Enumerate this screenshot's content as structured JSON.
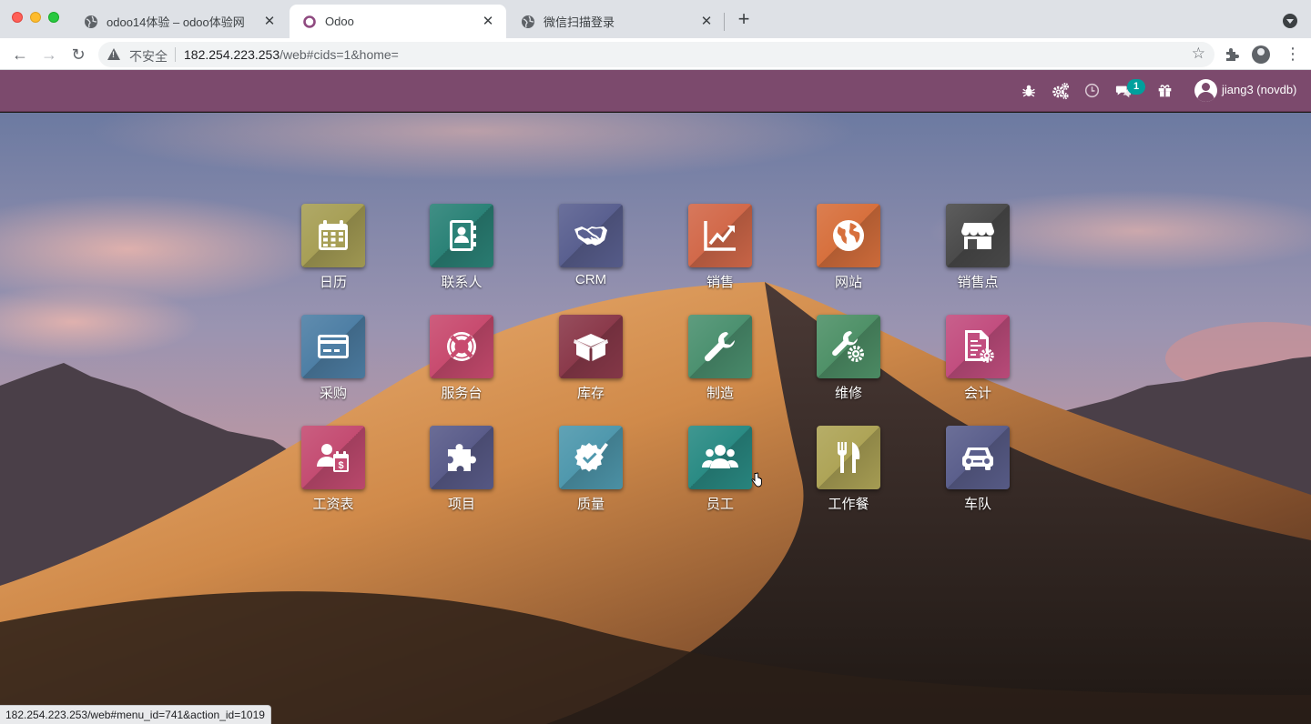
{
  "browser": {
    "tabs": [
      {
        "title": "odoo14体验 – odoo体验网",
        "favicon": "globe-icon",
        "active": false
      },
      {
        "title": "Odoo",
        "favicon": "odoo-icon",
        "active": true
      },
      {
        "title": "微信扫描登录",
        "favicon": "globe-icon",
        "active": false
      }
    ],
    "new_tab": "+",
    "security_label": "不安全",
    "url_host": "182.254.223.253",
    "url_path": "/web#cids=1&home=",
    "status_url": "182.254.223.253/web#menu_id=741&action_id=1019"
  },
  "navbar": {
    "icons": [
      "bug-icon",
      "gears-icon",
      "clock-icon",
      "chat-icon",
      "gift-icon"
    ],
    "message_badge": "1",
    "user": "jiang3 (novdb)"
  },
  "apps": [
    {
      "label": "日历",
      "icon": "calendar-icon",
      "color": "#a79f56"
    },
    {
      "label": "联系人",
      "icon": "contacts-icon",
      "color": "#2b8277"
    },
    {
      "label": "CRM",
      "icon": "handshake-icon",
      "color": "#5a6090"
    },
    {
      "label": "销售",
      "icon": "chart-line-icon",
      "color": "#d2694a"
    },
    {
      "label": "网站",
      "icon": "globe-icon",
      "color": "#d7703d"
    },
    {
      "label": "销售点",
      "icon": "store-icon",
      "color": "#4b4b4b"
    },
    {
      "label": "采购",
      "icon": "credit-card-icon",
      "color": "#4e7fa5"
    },
    {
      "label": "服务台",
      "icon": "lifebuoy-icon",
      "color": "#c84b6f"
    },
    {
      "label": "库存",
      "icon": "box-icon",
      "color": "#8b3a4b"
    },
    {
      "label": "制造",
      "icon": "wrench-icon",
      "color": "#4c9170"
    },
    {
      "label": "维修",
      "icon": "wrench-cog-icon",
      "color": "#4f9168"
    },
    {
      "label": "会计",
      "icon": "invoice-icon",
      "color": "#c24e7f"
    },
    {
      "label": "工资表",
      "icon": "payroll-icon",
      "color": "#c44c72"
    },
    {
      "label": "项目",
      "icon": "puzzle-icon",
      "color": "#5a5c8a"
    },
    {
      "label": "质量",
      "icon": "quality-badge-icon",
      "color": "#4f98ad"
    },
    {
      "label": "员工",
      "icon": "users-icon",
      "color": "#2a8b84"
    },
    {
      "label": "工作餐",
      "icon": "cutlery-icon",
      "color": "#aea457"
    },
    {
      "label": "车队",
      "icon": "car-icon",
      "color": "#5b5f8c"
    }
  ]
}
